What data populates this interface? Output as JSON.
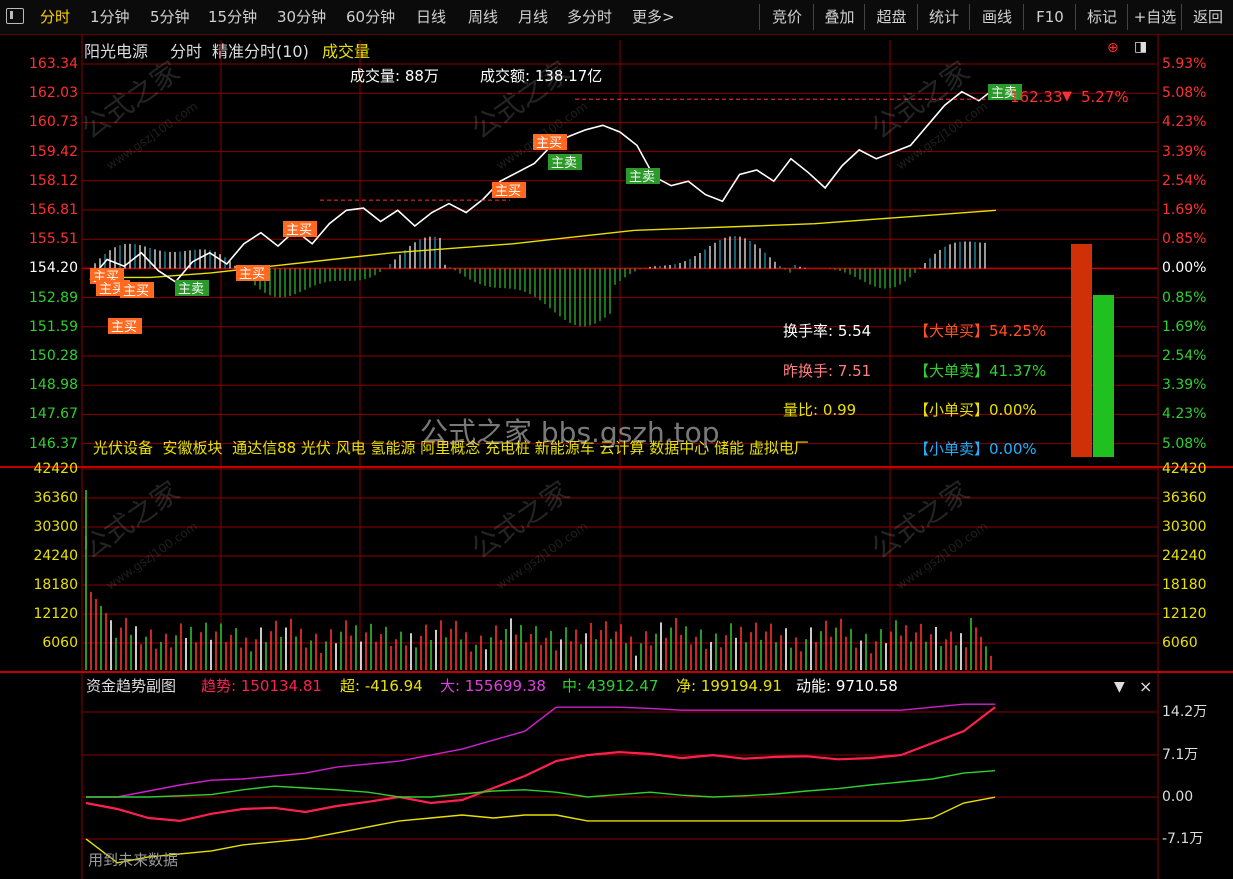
{
  "toolbar": {
    "left_items": [
      "分时",
      "1分钟",
      "5分钟",
      "15分钟",
      "30分钟",
      "60分钟",
      "日线",
      "周线",
      "月线",
      "多分时",
      "更多>"
    ],
    "active": "分时",
    "right_items": [
      "竞价",
      "叠加",
      "超盘",
      "统计",
      "画线",
      "F10",
      "标记",
      "+自选",
      "返回"
    ]
  },
  "header": {
    "stock": "阳光电源",
    "view": "分时",
    "precise": "精准分时(10)",
    "indicator": "成交量"
  },
  "volume_info": {
    "vol_label": "成交量: 88万",
    "amount_label": "成交额: 138.17亿"
  },
  "price_labels": [
    "163.34",
    "162.03",
    "160.73",
    "159.42",
    "158.12",
    "156.81",
    "155.51",
    "154.20",
    "152.89",
    "151.59",
    "150.28",
    "148.98",
    "147.67",
    "146.37"
  ],
  "pct_labels": [
    "5.93%",
    "5.08%",
    "4.23%",
    "3.39%",
    "2.54%",
    "1.69%",
    "0.85%",
    "0.00%",
    "0.85%",
    "1.69%",
    "2.54%",
    "3.39%",
    "4.23%",
    "5.08%"
  ],
  "current": {
    "price": "162.33",
    "change": "5.27%",
    "arrow": "▼"
  },
  "signal_tags": [
    {
      "label": "主买",
      "type": "buy"
    },
    {
      "label": "主卖",
      "type": "sell"
    }
  ],
  "stats": {
    "turnover": "换手率: 5.54",
    "prev_turnover": "昨换手: 7.51",
    "volume_ratio": "量比: 0.99",
    "big_buy": "【大单买】54.25%",
    "big_sell": "【大单卖】41.37%",
    "small_buy": "【小单买】0.00%",
    "small_sell": "【小单卖】0.00%"
  },
  "concepts": "光伏设备  安徽板块  通达信88 光伏 风电 氢能源 阿里概念 充电桩 新能源车 云计算 数据中心 储能 虚拟电厂",
  "watermark": "公式之家 bbs.gszh.top",
  "watermark_small": "公式之家",
  "watermark_url": "www.gszj100.com",
  "vol_labels": [
    "42420",
    "36360",
    "30300",
    "24240",
    "18180",
    "12120",
    "6060"
  ],
  "sub": {
    "title": "资金趋势副图",
    "trend": "趋势: 150134.81",
    "super": "超: -416.94",
    "big": "大: 155699.38",
    "mid": "中: 43912.47",
    "net": "净: 199194.91",
    "momentum": "动能: 9710.58",
    "axis": [
      "14.2万",
      "7.1万",
      "0.00",
      "-7.1万"
    ],
    "footer": "用到未来数据",
    "close": "×",
    "menu": "▼"
  },
  "colors": {
    "up": "#ff3030",
    "down": "#30c030",
    "grid": "#8a0000",
    "yellow": "#e8e000",
    "magenta": "#d020d0"
  },
  "chart_data": [
    {
      "type": "line",
      "title": "",
      "series": [
        {
          "values": [
            153.7,
            154.6,
            154.3,
            154.9,
            154.1,
            153.6,
            154.5,
            154.9,
            154.4,
            155.3,
            155.8,
            155.2,
            155.9,
            155.3,
            156.2,
            156.8,
            156.9,
            156.3,
            156.8,
            156.1,
            156.7,
            157.1,
            156.7,
            157.3,
            158.1,
            158.5,
            158.9,
            159.7,
            160.1,
            160.4,
            160.6,
            160.3,
            159.7,
            158.3,
            157.9,
            158.1,
            157.5,
            157.2,
            158.4,
            158.6,
            158.1,
            159.1,
            158.5,
            157.8,
            158.8,
            159.5,
            159.1,
            159.4,
            159.7,
            160.6,
            161.5,
            162.1,
            161.7,
            162.3
          ]
        },
        {
          "values": [
            153.8,
            153.8,
            154.0,
            154.3,
            154.6,
            154.9,
            155.1,
            155.3,
            155.6,
            155.9,
            156.0,
            156.1,
            156.2,
            156.4,
            156.6,
            156.8
          ]
        }
      ]
    },
    {
      "type": "line",
      "title": "资金趋势副图",
      "ylim": [
        -142000,
        142000
      ],
      "series": [
        {
          "name": "趋势",
          "values": [
            -10000,
            -20000,
            -35000,
            -40000,
            -28000,
            -20000,
            -18000,
            -25000,
            -15000,
            -8000,
            0,
            -10000,
            -5000,
            15000,
            35000,
            60000,
            70000,
            75000,
            72000,
            65000,
            70000,
            64000,
            67000,
            68000,
            63000,
            65000,
            70000,
            90000,
            110000,
            150000
          ]
        },
        {
          "name": "大",
          "values": [
            0,
            0,
            10000,
            20000,
            28000,
            30000,
            35000,
            40000,
            50000,
            55000,
            60000,
            70000,
            80000,
            95000,
            110000,
            150000,
            150000,
            150000,
            148000,
            145000,
            145000,
            145000,
            145000,
            145000,
            145000,
            145000,
            145000,
            150000,
            155000,
            155000
          ]
        },
        {
          "name": "中",
          "values": [
            0,
            0,
            0,
            2000,
            4000,
            12000,
            18000,
            15000,
            12000,
            8000,
            0,
            0,
            5000,
            10000,
            12000,
            8000,
            0,
            4000,
            8000,
            3000,
            0,
            2000,
            5000,
            10000,
            14000,
            20000,
            25000,
            30000,
            40000,
            43900
          ]
        },
        {
          "name": "超",
          "values": [
            -70000,
            -110000,
            -100000,
            -95000,
            -90000,
            -80000,
            -75000,
            -70000,
            -60000,
            -50000,
            -40000,
            -35000,
            -30000,
            -35000,
            -30000,
            -30000,
            -40000,
            -40000,
            -40000,
            -40000,
            -40000,
            -40000,
            -40000,
            -40000,
            -40000,
            -40000,
            -40000,
            -35000,
            -10000,
            -400
          ]
        }
      ]
    }
  ]
}
